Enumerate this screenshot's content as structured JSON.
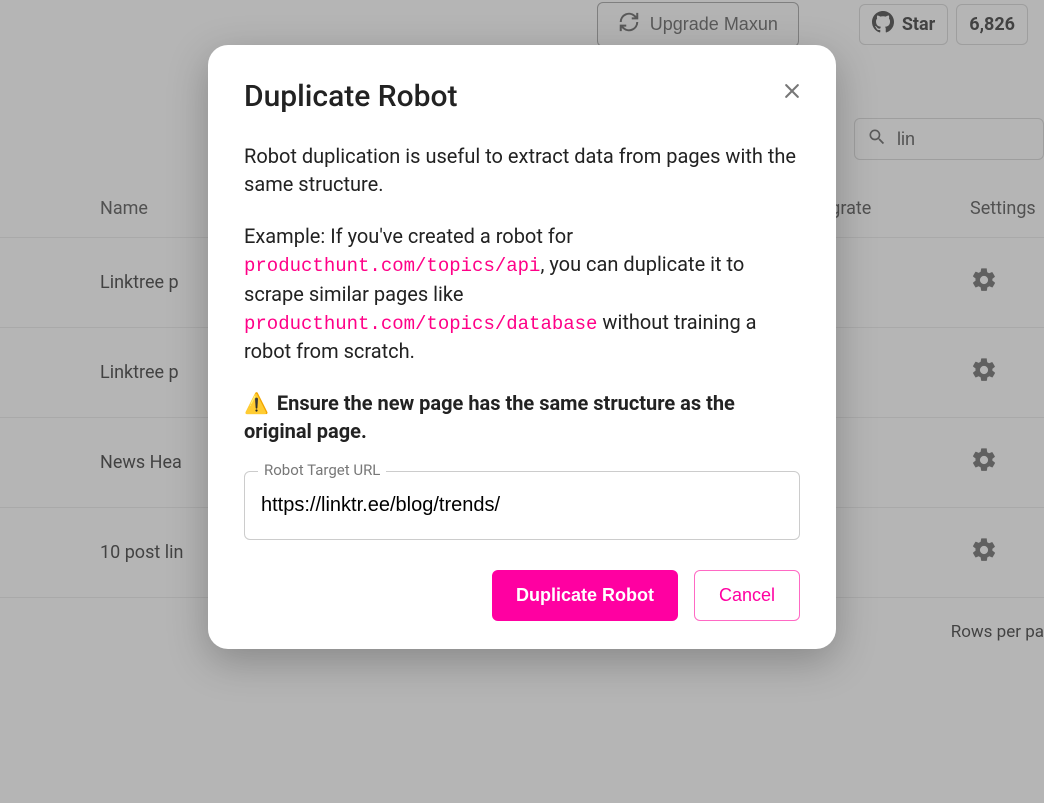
{
  "topbar": {
    "upgrade_label": "Upgrade Maxun",
    "star_label": "Star",
    "star_count": "6,826"
  },
  "search": {
    "value": "lin"
  },
  "columns": {
    "name": "Name",
    "integrate": "Integrate",
    "settings": "Settings"
  },
  "rows": [
    {
      "name": "Linktree p"
    },
    {
      "name": "Linktree p"
    },
    {
      "name": "News Hea"
    },
    {
      "name": "10 post lin"
    }
  ],
  "footer": {
    "rows_per_page": "Rows per pa"
  },
  "modal": {
    "title": "Duplicate Robot",
    "desc_intro": "Robot duplication is useful to extract data from pages with the same structure.",
    "example_prefix": "Example: If you've created a robot for ",
    "code1": "producthunt.com/topics/api",
    "example_mid": ", you can duplicate it to scrape similar pages like ",
    "code2": "producthunt.com/topics/database",
    "example_suffix": " without training a robot from scratch.",
    "warn_icon": "⚠️",
    "warn_text": "Ensure the new page has the same structure as the original page.",
    "input_label": "Robot Target URL",
    "input_value": "https://linktr.ee/blog/trends/",
    "duplicate_btn": "Duplicate Robot",
    "cancel_btn": "Cancel"
  }
}
